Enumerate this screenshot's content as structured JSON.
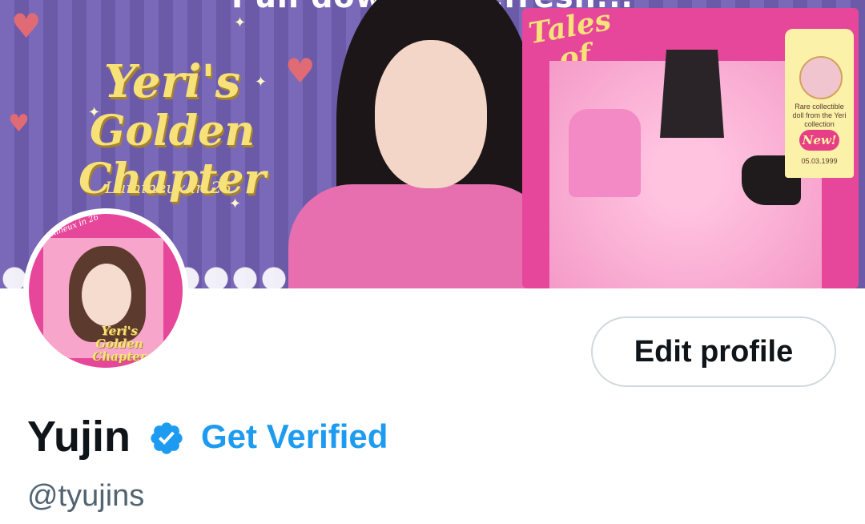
{
  "refresh": {
    "text": "Pull down to refresh..."
  },
  "banner": {
    "title_line1": "Yeri's",
    "title_line2": "Golden Chapter",
    "subtitle": "Lumineux in 26",
    "box_title": "Tales of Yeri",
    "tag_text": "Rare collectible doll from the Yeri collection",
    "tag_badge": "New!",
    "tag_date": "05.03.1999"
  },
  "avatar": {
    "top_text": "Lumineux in 26",
    "title": "Yeri's Golden Chapter"
  },
  "actions": {
    "edit_profile": "Edit profile"
  },
  "profile": {
    "name": "Yujin",
    "get_verified": "Get Verified",
    "handle": "@tyujins"
  },
  "colors": {
    "verified_blue": "#1d9bf0",
    "text_primary": "#0f1419",
    "text_secondary": "#536471",
    "button_border": "#cfd9de"
  },
  "icons": {
    "verified": "verified-badge-icon"
  }
}
